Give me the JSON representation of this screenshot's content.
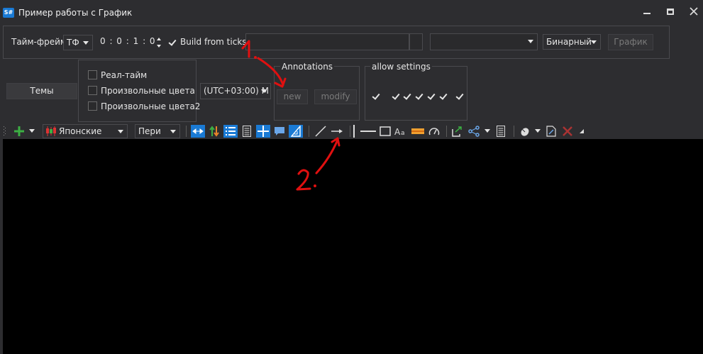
{
  "window": {
    "icon_text": "S#",
    "title": "Пример работы с График"
  },
  "top_panel": {
    "timeframe_label": "Тайм-фрейм",
    "timeframe_combo": "ТФ",
    "time_value": "0 : 0 : 1 : 0",
    "build_from_ticks_label": "Build from ticks",
    "build_from_ticks_checked": true,
    "security_value": "",
    "portfolio_value": "",
    "theme_combo": "Бинарный",
    "chart_button": "График"
  },
  "options": {
    "themes_button": "Темы",
    "realtime_label": "Реал-тайм",
    "custom_colors_label": "Произвольные цвета",
    "custom_colors2_label": "Произвольные цвета2",
    "timezone": "(UTC+03:00) M"
  },
  "annotations": {
    "title": "Annotations",
    "new_button": "new",
    "modify_button": "modify"
  },
  "allow_settings": {
    "title": "allow settings",
    "checks": [
      true,
      true,
      true,
      true,
      true,
      true,
      true
    ]
  },
  "toolbar": {
    "candle_type": "Японские",
    "period_combo": "Пери"
  },
  "annotation_marks": {
    "mark1": "1.",
    "mark2": "2."
  },
  "colors": {
    "background": "#2d2d30",
    "chart_bg": "#000000",
    "accent_blue": "#1a7ad4",
    "annotation_red": "#e01010"
  }
}
